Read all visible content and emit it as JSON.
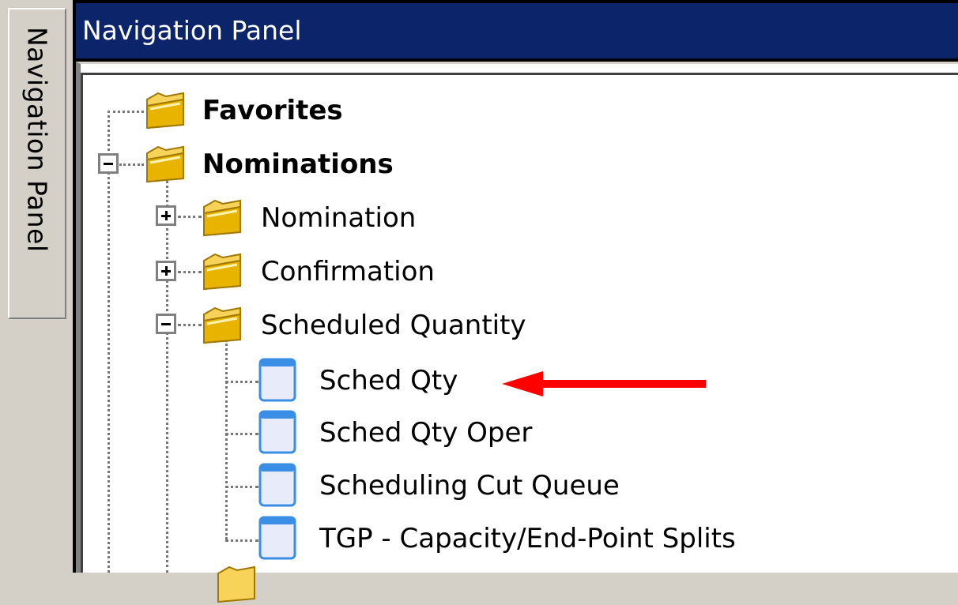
{
  "side_tab": {
    "label": "Navigation Panel"
  },
  "title_bar": {
    "title": "Navigation Panel"
  },
  "tree": {
    "items": [
      {
        "label": "Favorites",
        "type": "folder",
        "bold": true
      },
      {
        "label": "Nominations",
        "type": "folder",
        "bold": true,
        "expanded": true
      },
      {
        "label": "Nomination",
        "type": "folder",
        "expanded": false
      },
      {
        "label": "Confirmation",
        "type": "folder",
        "expanded": false
      },
      {
        "label": "Scheduled Quantity",
        "type": "folder",
        "expanded": true
      },
      {
        "label": "Sched Qty",
        "type": "document"
      },
      {
        "label": "Sched Qty Oper",
        "type": "document"
      },
      {
        "label": "Scheduling Cut Queue",
        "type": "document"
      },
      {
        "label": "TGP - Capacity/End-Point Splits",
        "type": "document"
      }
    ]
  },
  "colors": {
    "title_bar_bg": "#0c2469",
    "arrow": "#ff0000",
    "folder": "#e8b400",
    "document": "#5b9bd5"
  },
  "icons": [
    "folder-icon",
    "document-icon",
    "expand-icon",
    "collapse-icon",
    "arrow-icon"
  ]
}
